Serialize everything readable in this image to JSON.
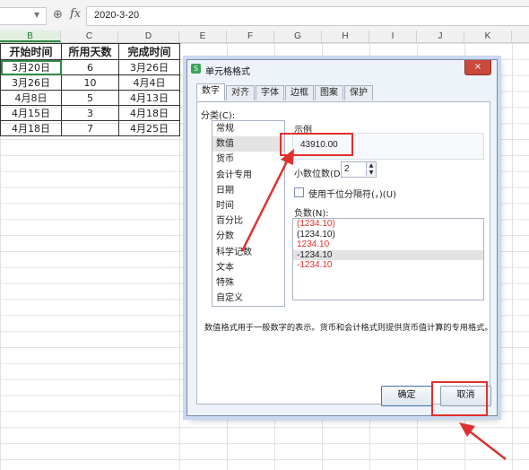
{
  "formula_bar": {
    "name_box": "",
    "zoom_icon": "⊕",
    "fx": "fx",
    "value": "2020-3-20"
  },
  "columns": [
    "B",
    "C",
    "D",
    "E",
    "F",
    "G",
    "H",
    "I",
    "J",
    "K"
  ],
  "table": {
    "headers": [
      "开始时间",
      "所用天数",
      "完成时间"
    ],
    "rows": [
      [
        "3月20日",
        "6",
        "3月26日"
      ],
      [
        "3月26日",
        "10",
        "4月4日"
      ],
      [
        "4月8日",
        "5",
        "4月13日"
      ],
      [
        "4月15日",
        "3",
        "4月18日"
      ],
      [
        "4月18日",
        "7",
        "4月25日"
      ]
    ]
  },
  "dialog": {
    "title": "单元格格式",
    "close": "×",
    "tabs": [
      "数字",
      "对齐",
      "字体",
      "边框",
      "图案",
      "保护"
    ],
    "category_label": "分类(C):",
    "categories": [
      "常规",
      "数值",
      "货币",
      "会计专用",
      "日期",
      "时间",
      "百分比",
      "分数",
      "科学记数",
      "文本",
      "特殊",
      "自定义"
    ],
    "selected_category": "数值",
    "sample_label": "示例",
    "sample_value": "43910.00",
    "decimal_label": "小数位数(D):",
    "decimal_value": "2",
    "thousands_label": "使用千位分隔符(，)(U)",
    "negative_label": "负数(N):",
    "negative_options": [
      {
        "text": "(1234.10)",
        "color": "#e0302e"
      },
      {
        "text": "(1234.10)",
        "color": "#222222"
      },
      {
        "text": "1234.10",
        "color": "#e0302e"
      },
      {
        "text": "-1234.10",
        "color": "#222222"
      },
      {
        "text": "-1234.10",
        "color": "#e0302e"
      }
    ],
    "selected_negative": 3,
    "description": "数值格式用于一般数字的表示。货币和会计格式则提供货币值计算的专用格式。",
    "ok": "确定",
    "cancel": "取消"
  },
  "colors": {
    "accent_green": "#2f8a45",
    "annotation_red": "#e0302e",
    "dialog_frame": "#c9d9ef"
  }
}
